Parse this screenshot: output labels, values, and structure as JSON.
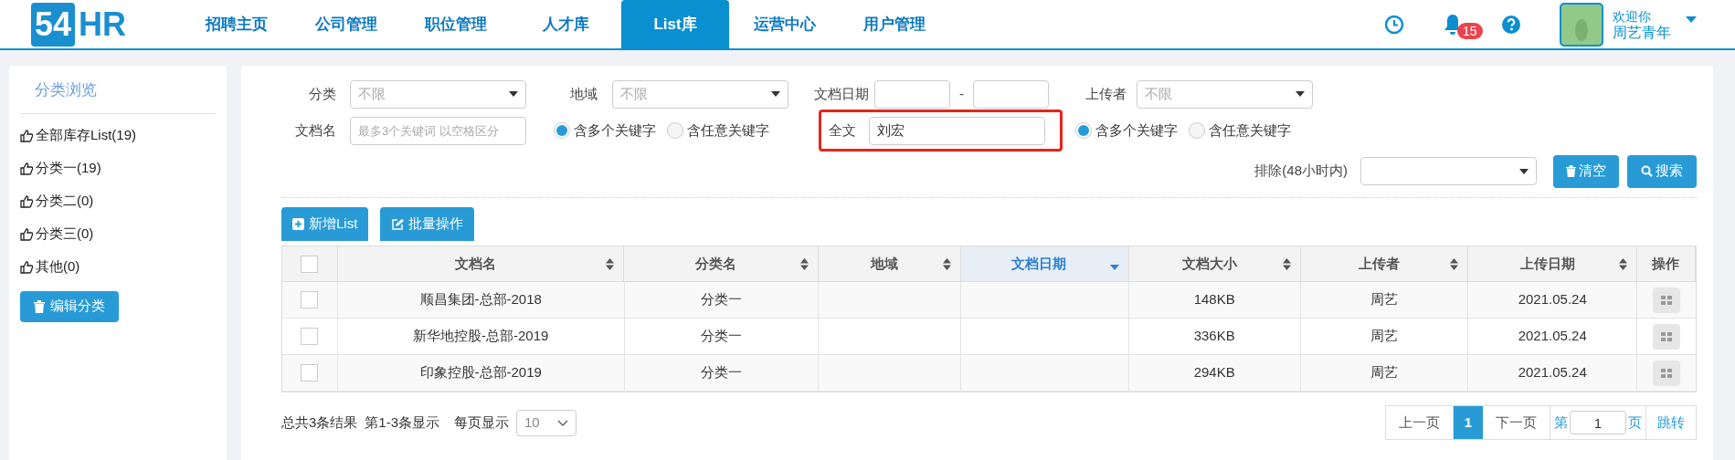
{
  "logo": {
    "number": "54",
    "letters": "HR"
  },
  "nav": [
    {
      "label": "招聘主页",
      "selected": false
    },
    {
      "label": "公司管理",
      "selected": false
    },
    {
      "label": "职位管理",
      "selected": false
    },
    {
      "label": "人才库",
      "selected": false
    },
    {
      "label": "List库",
      "selected": true
    },
    {
      "label": "运营中心",
      "selected": false
    },
    {
      "label": "用户管理",
      "selected": false
    }
  ],
  "header": {
    "notification_count": "15",
    "greeting": "欢迎你",
    "user_name": "周艺青年"
  },
  "sidebar": {
    "title": "分类浏览",
    "items": [
      {
        "label": "全部库存List(19)"
      },
      {
        "label": "分类一(19)"
      },
      {
        "label": "分类二(0)"
      },
      {
        "label": "分类三(0)"
      },
      {
        "label": "其他(0)"
      }
    ],
    "button": "编辑分类"
  },
  "filters": {
    "category": {
      "label": "分类",
      "placeholder": "不限"
    },
    "region": {
      "label": "地域",
      "placeholder": "不限"
    },
    "doc_date": {
      "label": "文档日期",
      "separator": "-"
    },
    "uploader": {
      "label": "上传者",
      "placeholder": "不限"
    },
    "doc_name": {
      "label": "文档名",
      "placeholder": "最多3个关键词 以空格区分",
      "options": [
        {
          "label": "含多个关键字",
          "selected": true
        },
        {
          "label": "含任意关键字",
          "selected": false
        }
      ]
    },
    "full_text": {
      "label": "全文",
      "value": "刘宏",
      "highlighted": true,
      "options": [
        {
          "label": "含多个关键字",
          "selected": true
        },
        {
          "label": "含任意关键字",
          "selected": false
        }
      ]
    },
    "exclude": {
      "label": "排除(48小时内)"
    },
    "clear_button": "清空",
    "search_button": "搜索"
  },
  "actions": [
    "新增List",
    "批量操作"
  ],
  "table": {
    "all_checked": false,
    "columns": [
      {
        "label": "文档名",
        "sortable": true,
        "sorted": false
      },
      {
        "label": "分类名",
        "sortable": true,
        "sorted": false
      },
      {
        "label": "地域",
        "sortable": true,
        "sorted": false
      },
      {
        "label": "文档日期",
        "sortable": true,
        "sorted": true
      },
      {
        "label": "文档大小",
        "sortable": true,
        "sorted": false
      },
      {
        "label": "上传者",
        "sortable": true,
        "sorted": false
      },
      {
        "label": "上传日期",
        "sortable": true,
        "sorted": false
      },
      {
        "label": "操作",
        "sortable": false,
        "sorted": false
      }
    ],
    "rows": [
      {
        "checked": false,
        "cells": [
          "顺昌集团-总部-2018",
          "分类一",
          "",
          "",
          "148KB",
          "周艺",
          "2021.05.24"
        ]
      },
      {
        "checked": false,
        "cells": [
          "新华地控股-总部-2019",
          "分类一",
          "",
          "",
          "336KB",
          "周艺",
          "2021.05.24"
        ]
      },
      {
        "checked": false,
        "cells": [
          "印象控股-总部-2019",
          "分类一",
          "",
          "",
          "294KB",
          "周艺",
          "2021.05.24"
        ]
      }
    ]
  },
  "footer": {
    "total": "总共3条结果",
    "range": "第1-3条显示",
    "per_page_label": "每页显示",
    "per_page": "10"
  },
  "pagination": {
    "prev": "上一页",
    "pages": [
      {
        "label": "1",
        "selected": true
      }
    ],
    "next": "下一页",
    "goto_prefix": "第",
    "goto_value": "1",
    "goto_suffix": "页",
    "goto_button": "跳转"
  }
}
